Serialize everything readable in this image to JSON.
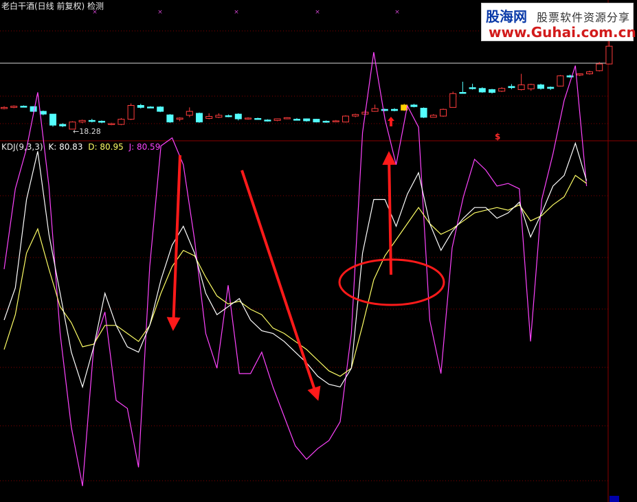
{
  "header": {
    "title": "老白干酒(日线 前复权) 检测",
    "kdj_label": "KDJ(9,3,3)",
    "k_text": "K: 80.83",
    "d_text": "D: 80.95",
    "j_text": "J: 80.59",
    "low_marker": "←18.28",
    "signal_mark": "$"
  },
  "watermark": {
    "brand": "股海网",
    "slogan": "股票软件资源分享",
    "url": "www.Guhai.com.cn"
  },
  "colors": {
    "background": "#000000",
    "rise": "#ff3c3c",
    "fall": "#54ffff",
    "k_line": "#ffffff",
    "d_line": "#ffff66",
    "j_line": "#ff44ff",
    "annotation": "#ff1a1a",
    "grid": "#8a0000"
  },
  "chart_data": [
    {
      "type": "candlestick",
      "title": "老白干酒(日线 前复权)",
      "annotations": [
        "←18.28"
      ],
      "candles": [
        {
          "o": 0.52,
          "c": 0.55,
          "h": 0.58,
          "l": 0.5,
          "dir": "up"
        },
        {
          "o": 0.55,
          "c": 0.58,
          "h": 0.6,
          "l": 0.53,
          "dir": "up"
        },
        {
          "o": 0.58,
          "c": 0.57,
          "h": 0.6,
          "l": 0.55,
          "dir": "down"
        },
        {
          "o": 0.57,
          "c": 0.45,
          "h": 0.58,
          "l": 0.43,
          "dir": "down"
        },
        {
          "o": 0.45,
          "c": 0.38,
          "h": 0.47,
          "l": 0.35,
          "dir": "down"
        },
        {
          "o": 0.38,
          "c": 0.1,
          "h": 0.38,
          "l": 0.06,
          "dir": "down"
        },
        {
          "o": 0.12,
          "c": 0.08,
          "h": 0.15,
          "l": 0.05,
          "dir": "down"
        },
        {
          "o": 0.0,
          "c": 0.18,
          "h": 0.2,
          "l": 0.0,
          "dir": "up"
        },
        {
          "o": 0.18,
          "c": 0.22,
          "h": 0.24,
          "l": 0.15,
          "dir": "up"
        },
        {
          "o": 0.22,
          "c": 0.2,
          "h": 0.26,
          "l": 0.17,
          "dir": "down"
        },
        {
          "o": 0.2,
          "c": 0.18,
          "h": 0.22,
          "l": 0.15,
          "dir": "down"
        },
        {
          "o": 0.12,
          "c": 0.14,
          "h": 0.16,
          "l": 0.1,
          "dir": "up"
        },
        {
          "o": 0.12,
          "c": 0.25,
          "h": 0.28,
          "l": 0.1,
          "dir": "up"
        },
        {
          "o": 0.25,
          "c": 0.6,
          "h": 0.65,
          "l": 0.23,
          "dir": "up"
        },
        {
          "o": 0.6,
          "c": 0.55,
          "h": 0.64,
          "l": 0.52,
          "dir": "down"
        },
        {
          "o": 0.55,
          "c": 0.56,
          "h": 0.58,
          "l": 0.53,
          "dir": "down"
        },
        {
          "o": 0.56,
          "c": 0.45,
          "h": 0.58,
          "l": 0.43,
          "dir": "down"
        },
        {
          "o": 0.36,
          "c": 0.18,
          "h": 0.38,
          "l": 0.16,
          "dir": "down"
        },
        {
          "o": 0.25,
          "c": 0.28,
          "h": 0.3,
          "l": 0.2,
          "dir": "up"
        },
        {
          "o": 0.35,
          "c": 0.45,
          "h": 0.55,
          "l": 0.3,
          "dir": "up"
        },
        {
          "o": 0.4,
          "c": 0.18,
          "h": 0.42,
          "l": 0.16,
          "dir": "down"
        },
        {
          "o": 0.27,
          "c": 0.32,
          "h": 0.4,
          "l": 0.25,
          "dir": "up"
        },
        {
          "o": 0.3,
          "c": 0.35,
          "h": 0.4,
          "l": 0.28,
          "dir": "up"
        },
        {
          "o": 0.34,
          "c": 0.32,
          "h": 0.37,
          "l": 0.3,
          "dir": "down"
        },
        {
          "o": 0.38,
          "c": 0.26,
          "h": 0.4,
          "l": 0.22,
          "dir": "down"
        },
        {
          "o": 0.26,
          "c": 0.28,
          "h": 0.3,
          "l": 0.24,
          "dir": "up"
        },
        {
          "o": 0.25,
          "c": 0.27,
          "h": 0.29,
          "l": 0.24,
          "dir": "down"
        },
        {
          "o": 0.23,
          "c": 0.21,
          "h": 0.25,
          "l": 0.19,
          "dir": "down"
        },
        {
          "o": 0.22,
          "c": 0.26,
          "h": 0.27,
          "l": 0.2,
          "dir": "up"
        },
        {
          "o": 0.26,
          "c": 0.29,
          "h": 0.3,
          "l": 0.25,
          "dir": "up"
        },
        {
          "o": 0.25,
          "c": 0.24,
          "h": 0.28,
          "l": 0.22,
          "dir": "down"
        },
        {
          "o": 0.26,
          "c": 0.21,
          "h": 0.27,
          "l": 0.19,
          "dir": "down"
        },
        {
          "o": 0.25,
          "c": 0.18,
          "h": 0.26,
          "l": 0.17,
          "dir": "down"
        },
        {
          "o": 0.2,
          "c": 0.18,
          "h": 0.22,
          "l": 0.16,
          "dir": "down"
        },
        {
          "o": 0.19,
          "c": 0.21,
          "h": 0.23,
          "l": 0.18,
          "dir": "up"
        },
        {
          "o": 0.18,
          "c": 0.33,
          "h": 0.35,
          "l": 0.17,
          "dir": "up"
        },
        {
          "o": 0.33,
          "c": 0.37,
          "h": 0.39,
          "l": 0.3,
          "dir": "up"
        },
        {
          "o": 0.38,
          "c": 0.43,
          "h": 0.48,
          "l": 0.36,
          "dir": "up"
        },
        {
          "o": 0.45,
          "c": 0.52,
          "h": 0.62,
          "l": 0.44,
          "dir": "up"
        },
        {
          "o": 0.5,
          "c": 0.47,
          "h": 0.52,
          "l": 0.45,
          "dir": "down"
        },
        {
          "o": 0.47,
          "c": 0.5,
          "h": 0.53,
          "l": 0.45,
          "dir": "down"
        },
        {
          "o": 0.48,
          "c": 0.61,
          "h": 0.64,
          "l": 0.46,
          "dir": "signal"
        },
        {
          "o": 0.61,
          "c": 0.57,
          "h": 0.64,
          "l": 0.55,
          "dir": "down"
        },
        {
          "o": 0.53,
          "c": 0.3,
          "h": 0.55,
          "l": 0.28,
          "dir": "down"
        },
        {
          "o": 0.3,
          "c": 0.35,
          "h": 0.38,
          "l": 0.3,
          "dir": "up"
        },
        {
          "o": 0.33,
          "c": 0.5,
          "h": 0.52,
          "l": 0.31,
          "dir": "up"
        },
        {
          "o": 0.55,
          "c": 0.9,
          "h": 0.95,
          "l": 0.55,
          "dir": "up"
        },
        {
          "o": 0.93,
          "c": 0.92,
          "h": 1.2,
          "l": 0.9,
          "dir": "down"
        },
        {
          "o": 1.05,
          "c": 1.03,
          "h": 1.15,
          "l": 1.0,
          "dir": "down"
        },
        {
          "o": 1.03,
          "c": 0.94,
          "h": 1.06,
          "l": 0.92,
          "dir": "down"
        },
        {
          "o": 1.0,
          "c": 0.93,
          "h": 1.02,
          "l": 0.9,
          "dir": "down"
        },
        {
          "o": 0.96,
          "c": 1.03,
          "h": 1.06,
          "l": 0.94,
          "dir": "up"
        },
        {
          "o": 1.08,
          "c": 1.05,
          "h": 1.14,
          "l": 1.01,
          "dir": "down"
        },
        {
          "o": 1.0,
          "c": 1.12,
          "h": 1.4,
          "l": 0.98,
          "dir": "up"
        },
        {
          "o": 1.02,
          "c": 1.13,
          "h": 1.15,
          "l": 0.97,
          "dir": "up"
        },
        {
          "o": 1.12,
          "c": 1.03,
          "h": 1.15,
          "l": 1.0,
          "dir": "down"
        },
        {
          "o": 1.06,
          "c": 1.03,
          "h": 1.08,
          "l": 0.99,
          "dir": "down"
        },
        {
          "o": 1.09,
          "c": 1.35,
          "h": 1.37,
          "l": 1.08,
          "dir": "up"
        },
        {
          "o": 1.35,
          "c": 1.32,
          "h": 1.38,
          "l": 1.3,
          "dir": "down"
        },
        {
          "o": 1.37,
          "c": 1.4,
          "h": 1.41,
          "l": 1.34,
          "dir": "up"
        },
        {
          "o": 1.4,
          "c": 1.45,
          "h": 1.48,
          "l": 1.38,
          "dir": "up"
        },
        {
          "o": 1.48,
          "c": 1.65,
          "h": 1.7,
          "l": 1.46,
          "dir": "up"
        },
        {
          "o": 1.65,
          "c": 2.1,
          "h": 2.3,
          "l": 1.64,
          "dir": "up"
        }
      ]
    },
    {
      "type": "line",
      "title": "KDJ(9,3,3)",
      "series": [
        {
          "name": "K",
          "values": [
            30,
            42,
            75,
            93,
            62,
            40,
            18,
            5,
            20,
            40,
            28,
            20,
            18,
            28,
            45,
            58,
            65,
            55,
            40,
            32,
            35,
            38,
            30,
            26,
            25,
            22,
            18,
            14,
            9,
            6,
            5,
            12,
            55,
            75,
            75,
            65,
            77,
            85,
            66,
            56,
            63,
            68,
            72,
            72,
            68,
            70,
            74,
            61,
            70,
            80,
            84,
            96,
            82
          ]
        },
        {
          "name": "D",
          "values": [
            19,
            32,
            55,
            64,
            49,
            35,
            29,
            20,
            21,
            28,
            28,
            25,
            22,
            28,
            40,
            50,
            56,
            54,
            46,
            39,
            36,
            37,
            34,
            32,
            27,
            25,
            22,
            19,
            15,
            11,
            9,
            12,
            28,
            45,
            54,
            60,
            66,
            72,
            66,
            62,
            64,
            67,
            70,
            71,
            72,
            71,
            73,
            67,
            69,
            73,
            76,
            84,
            81
          ]
        },
        {
          "name": "J",
          "values": [
            49,
            79,
            94,
            115,
            80,
            25,
            -10,
            -32,
            20,
            33,
            0,
            -3,
            -25,
            50,
            95,
            98,
            88,
            60,
            25,
            12,
            43,
            10,
            10,
            18,
            5,
            -6,
            -17,
            -22,
            -18,
            -15,
            -8,
            25,
            100,
            130,
            105,
            88,
            110,
            102,
            30,
            10,
            57,
            76,
            90,
            86,
            80,
            81,
            79,
            22,
            75,
            92,
            112,
            125,
            80
          ]
        }
      ]
    }
  ]
}
